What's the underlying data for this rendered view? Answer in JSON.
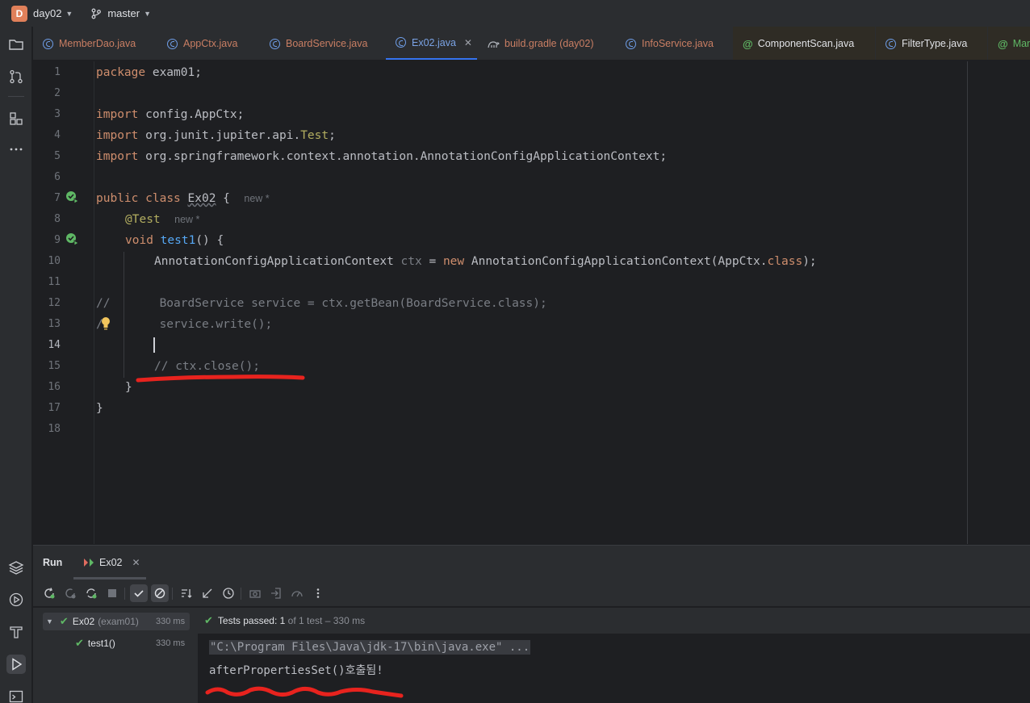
{
  "titlebar": {
    "project_initial": "D",
    "project": "day02",
    "branch": "master"
  },
  "tabs": [
    {
      "label": "MemberDao.java"
    },
    {
      "label": "AppCtx.java"
    },
    {
      "label": "BoardService.java"
    },
    {
      "label": "Ex02.java"
    },
    {
      "label": "build.gradle (day02)"
    },
    {
      "label": "InfoService.java"
    },
    {
      "label": "ComponentScan.java"
    },
    {
      "label": "FilterType.java"
    },
    {
      "label": "Man"
    }
  ],
  "editor": {
    "line_numbers": [
      "1",
      "2",
      "3",
      "4",
      "5",
      "6",
      "7",
      "8",
      "9",
      "10",
      "11",
      "12",
      "13",
      "14",
      "15",
      "16",
      "17",
      "18"
    ],
    "l1_kw": "package",
    "l1_rest": " exam01;",
    "l3_kw": "import",
    "l3_rest": " config.AppCtx;",
    "l4_kw": "import",
    "l4_rest": " org.junit.jupiter.api.",
    "l4_cls": "Test",
    "l4_end": ";",
    "l5_kw": "import",
    "l5_rest": " org.springframework.context.annotation.AnnotationConfigApplicationContext;",
    "l7_kw1": "public",
    "l7_kw2": "class",
    "l7_name": "Ex02",
    "l7_brace": " {",
    "l7_hint": "new *",
    "l8_ann": "@Test",
    "l8_hint": "new *",
    "l9_kw": "void",
    "l9_fn": "test1",
    "l9_rest": "() {",
    "l10_type": "AnnotationConfigApplicationContext",
    "l10_var": " ctx",
    "l10_eq": " = ",
    "l10_new": "new",
    "l10_ctor": " AnnotationConfigApplicationContext(AppCtx.",
    "l10_class": "class",
    "l10_end": ");",
    "l12_cm": "//",
    "l12_code": "BoardService service = ctx.getBean(BoardService.class);",
    "l13_cm": "/",
    "l13_code": "service.write();",
    "l15_cm": "// ctx.close();",
    "l16": "}",
    "l17": "}"
  },
  "run": {
    "title": "Run",
    "tab": "Ex02",
    "tree": [
      {
        "name": "Ex02",
        "pkg": "(exam01)",
        "time": "330 ms"
      },
      {
        "name": "test1()",
        "time": "330 ms"
      }
    ],
    "status_prefix": "Tests passed:",
    "status_count": "1",
    "status_of": "of",
    "status_total": "1 test",
    "status_time": "– 330 ms",
    "console": [
      "\"C:\\Program Files\\Java\\jdk-17\\bin\\java.exe\" ...",
      "afterPropertiesSet()호출됨!"
    ]
  },
  "colors": {
    "accent": "#3574f0",
    "keyword": "#cf8e6d",
    "annotation": "#b3ae60",
    "method": "#56a8f5",
    "success": "#5fb865",
    "red_marker": "#e8231e"
  }
}
